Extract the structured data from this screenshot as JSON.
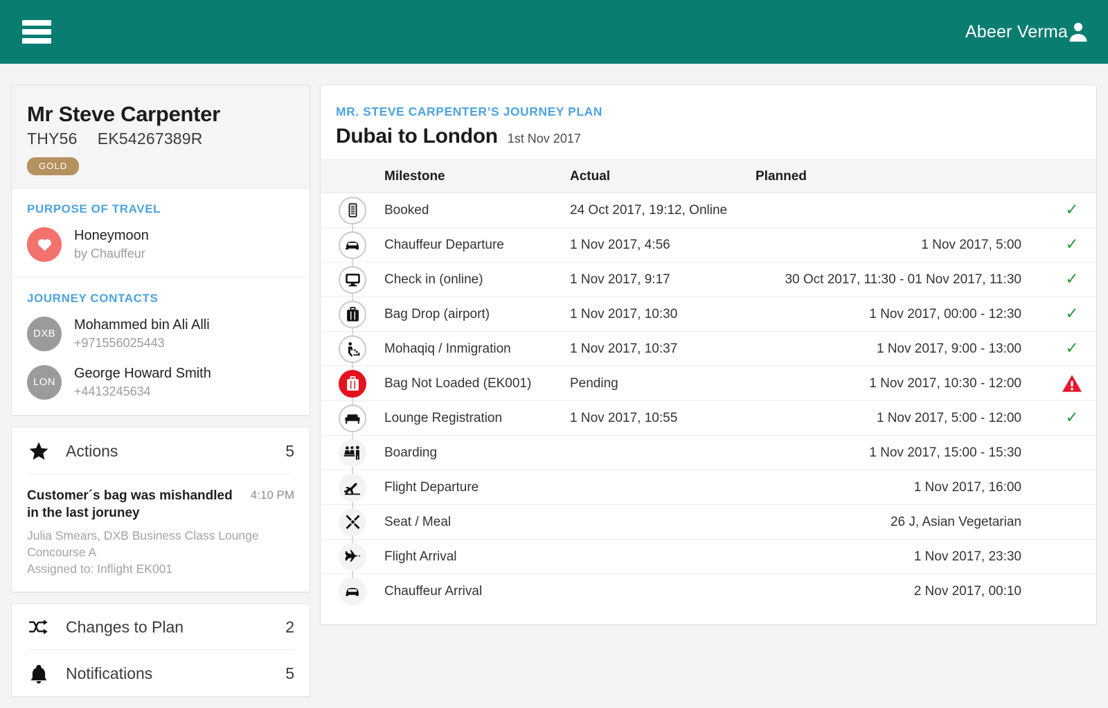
{
  "topbar": {
    "menu_icon": "hamburger-icon",
    "user_name": "Abeer Verma",
    "user_icon": "person-icon",
    "background_color": "#0a7d71"
  },
  "sidebar": {
    "passenger": {
      "name": "Mr Steve Carpenter",
      "record_locator": "THY56",
      "ticket_number": "EK54267389R",
      "tier_badge": "GOLD",
      "tier_color": "#b5915f"
    },
    "purpose": {
      "title": "PURPOSE OF TRAVEL",
      "icon": "heart-icon",
      "icon_color": "#f4726e",
      "label": "Honeymoon",
      "sub": "by Chauffeur"
    },
    "contacts": {
      "title": "JOURNEY CONTACTS",
      "items": [
        {
          "code": "DXB",
          "name": "Mohammed bin Ali Alli",
          "phone": "+971556025443"
        },
        {
          "code": "LON",
          "name": "George Howard Smith",
          "phone": "+4413245634"
        }
      ]
    },
    "actions": {
      "icon": "star-icon",
      "label": "Actions",
      "count": "5",
      "note": {
        "title": "Customer´s bag was mishandled in the last joruney",
        "time": "4:10 PM",
        "meta_line1": "Julia Smears, DXB Business Class Lounge Concourse A",
        "meta_line2": "Assigned to: Inflight EK001"
      }
    },
    "changes": {
      "icon": "shuffle-icon",
      "label": "Changes to Plan",
      "count": "2"
    },
    "notifications": {
      "icon": "bell-icon",
      "label": "Notifications",
      "count": "5"
    }
  },
  "main": {
    "kicker": "MR. STEVE CARPENTER’S JOURNEY PLAN",
    "route": "Dubai to London",
    "route_date": "1st Nov 2017",
    "columns": {
      "milestone": "Milestone",
      "actual": "Actual",
      "planned": "Planned"
    },
    "status_ok_color": "#1f9d32",
    "status_alert_color": "#e8192c",
    "rows": [
      {
        "icon": "ticket-icon",
        "node": "ring",
        "milestone": "Booked",
        "actual": "24 Oct 2017, 19:12, Online",
        "planned": "",
        "status": "ok"
      },
      {
        "icon": "car-icon",
        "node": "ring",
        "milestone": "Chauffeur Departure",
        "actual": "1 Nov 2017,  4:56",
        "planned": "1 Nov 2017,  5:00",
        "status": "ok"
      },
      {
        "icon": "monitor-icon",
        "node": "ring",
        "milestone": "Check in (online)",
        "actual": "1 Nov 2017,  9:17",
        "planned": "30 Oct 2017, 11:30 - 01 Nov 2017, 11:30",
        "status": "ok"
      },
      {
        "icon": "suitcase-icon",
        "node": "ring",
        "milestone": "Bag Drop (airport)",
        "actual": "1 Nov 2017,  10:30",
        "planned": "1 Nov 2017,  00:00 - 12:30",
        "status": "ok"
      },
      {
        "icon": "immigration-icon",
        "node": "ring",
        "milestone": "Mohaqiq / Inmigration",
        "actual": "1 Nov 2017,  10:37",
        "planned": "1 Nov 2017,   9:00 - 13:00",
        "status": "ok"
      },
      {
        "icon": "bag-alert-icon",
        "node": "danger",
        "milestone": "Bag Not Loaded (EK001)",
        "actual": "Pending",
        "planned": "1 Nov 2017,  10:30 - 12:00",
        "status": "alert"
      },
      {
        "icon": "lounge-icon",
        "node": "ring",
        "milestone": "Lounge Registration",
        "actual": "1 Nov 2017,  10:55",
        "planned": "1 Nov 2017,   5:00 - 12:00",
        "status": "ok"
      },
      {
        "icon": "boarding-icon",
        "node": "plain",
        "milestone": "Boarding",
        "actual": "",
        "planned": "1 Nov 2017,   15:00 - 15:30",
        "status": ""
      },
      {
        "icon": "plane-depart-icon",
        "node": "plain",
        "milestone": "Flight Departure",
        "actual": "",
        "planned": "1 Nov 2017, 16:00",
        "status": ""
      },
      {
        "icon": "meal-icon",
        "node": "plain",
        "milestone": "Seat / Meal",
        "actual": "",
        "planned": "26 J, Asian Vegetarian",
        "status": ""
      },
      {
        "icon": "plane-arrive-icon",
        "node": "plain",
        "milestone": "Flight Arrival",
        "actual": "",
        "planned": "1 Nov 2017,  23:30",
        "status": ""
      },
      {
        "icon": "car-icon",
        "node": "plain",
        "milestone": "Chauffeur Arrival",
        "actual": "",
        "planned": "2 Nov 2017,  00:10",
        "status": ""
      }
    ]
  }
}
